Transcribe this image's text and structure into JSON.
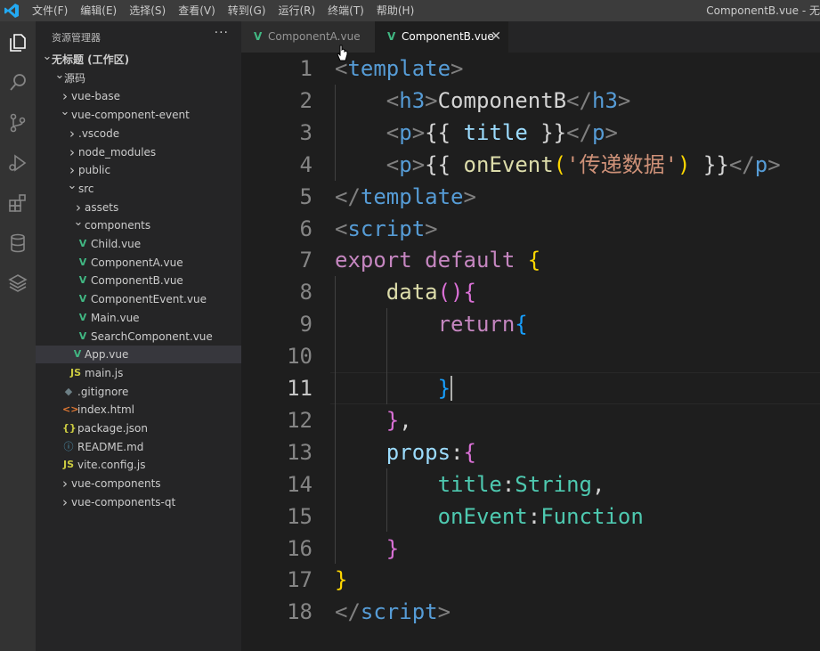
{
  "menu": [
    "文件(F)",
    "编辑(E)",
    "选择(S)",
    "查看(V)",
    "转到(G)",
    "运行(R)",
    "终端(T)",
    "帮助(H)"
  ],
  "window_title": "ComponentB.vue - 无",
  "activity_icons": [
    "explorer-icon",
    "search-icon",
    "source-control-icon",
    "run-debug-icon",
    "extensions-icon",
    "database-icon",
    "layers-icon"
  ],
  "sidebar": {
    "header": "资源管理器",
    "more": "···",
    "tree": [
      {
        "label": "无标题 (工作区)",
        "icon": "chevron-down",
        "bold": true
      },
      {
        "label": "源码",
        "icon": "chevron-down"
      },
      {
        "label": "vue-base",
        "icon": "chevron-right"
      },
      {
        "label": "vue-component-event",
        "icon": "chevron-down"
      },
      {
        "label": ".vscode",
        "icon": "chevron-right"
      },
      {
        "label": "node_modules",
        "icon": "chevron-right"
      },
      {
        "label": "public",
        "icon": "chevron-right"
      },
      {
        "label": "src",
        "icon": "chevron-down"
      },
      {
        "label": "assets",
        "icon": "chevron-right"
      },
      {
        "label": "components",
        "icon": "chevron-down"
      },
      {
        "label": "Child.vue",
        "icon": "vue"
      },
      {
        "label": "ComponentA.vue",
        "icon": "vue"
      },
      {
        "label": "ComponentB.vue",
        "icon": "vue"
      },
      {
        "label": "ComponentEvent.vue",
        "icon": "vue"
      },
      {
        "label": "Main.vue",
        "icon": "vue"
      },
      {
        "label": "SearchComponent.vue",
        "icon": "vue"
      },
      {
        "label": "App.vue",
        "icon": "vue",
        "selected": true
      },
      {
        "label": "main.js",
        "icon": "js"
      },
      {
        "label": ".gitignore",
        "icon": "git"
      },
      {
        "label": "index.html",
        "icon": "html"
      },
      {
        "label": "package.json",
        "icon": "json"
      },
      {
        "label": "README.md",
        "icon": "md"
      },
      {
        "label": "vite.config.js",
        "icon": "js"
      },
      {
        "label": "vue-components",
        "icon": "chevron-right"
      },
      {
        "label": "vue-components-qt",
        "icon": "chevron-right"
      }
    ]
  },
  "tabs": [
    {
      "label": "ComponentA.vue",
      "active": false
    },
    {
      "label": "ComponentB.vue",
      "active": true,
      "close": "✕"
    }
  ],
  "editor": {
    "current_line": 11,
    "lines": [
      {
        "n": "1",
        "tokens": [
          [
            "<",
            "pun"
          ],
          [
            "template",
            "tag"
          ],
          [
            ">",
            "pun"
          ]
        ]
      },
      {
        "n": "2",
        "tokens": [
          [
            "    ",
            "txt"
          ],
          [
            "<",
            "pun"
          ],
          [
            "h3",
            "tag"
          ],
          [
            ">",
            "pun"
          ],
          [
            "ComponentB",
            "txt"
          ],
          [
            "</",
            "pun"
          ],
          [
            "h3",
            "tag"
          ],
          [
            ">",
            "pun"
          ]
        ]
      },
      {
        "n": "3",
        "tokens": [
          [
            "    ",
            "txt"
          ],
          [
            "<",
            "pun"
          ],
          [
            "p",
            "tag"
          ],
          [
            ">",
            "pun"
          ],
          [
            "{{ ",
            "txt"
          ],
          [
            "title",
            "var"
          ],
          [
            " }}",
            "txt"
          ],
          [
            "</",
            "pun"
          ],
          [
            "p",
            "tag"
          ],
          [
            ">",
            "pun"
          ]
        ]
      },
      {
        "n": "4",
        "tokens": [
          [
            "    ",
            "txt"
          ],
          [
            "<",
            "pun"
          ],
          [
            "p",
            "tag"
          ],
          [
            ">",
            "pun"
          ],
          [
            "{{ ",
            "txt"
          ],
          [
            "onEvent",
            "fn"
          ],
          [
            "(",
            "br1"
          ],
          [
            "'传递数据'",
            "str"
          ],
          [
            ")",
            "br1"
          ],
          [
            " }}",
            "txt"
          ],
          [
            "</",
            "pun"
          ],
          [
            "p",
            "tag"
          ],
          [
            ">",
            "pun"
          ]
        ]
      },
      {
        "n": "5",
        "tokens": [
          [
            "</",
            "pun"
          ],
          [
            "template",
            "tag"
          ],
          [
            ">",
            "pun"
          ]
        ]
      },
      {
        "n": "6",
        "tokens": [
          [
            "<",
            "pun"
          ],
          [
            "script",
            "tag"
          ],
          [
            ">",
            "pun"
          ]
        ]
      },
      {
        "n": "7",
        "tokens": [
          [
            "export",
            "kw"
          ],
          [
            " ",
            "txt"
          ],
          [
            "default",
            "kw"
          ],
          [
            " ",
            "txt"
          ],
          [
            "{",
            "br1"
          ]
        ]
      },
      {
        "n": "8",
        "tokens": [
          [
            "    ",
            "txt"
          ],
          [
            "data",
            "fn"
          ],
          [
            "()",
            "br2"
          ],
          [
            "{",
            "br2"
          ]
        ]
      },
      {
        "n": "9",
        "tokens": [
          [
            "        ",
            "txt"
          ],
          [
            "return",
            "kw"
          ],
          [
            "{",
            "br3"
          ]
        ]
      },
      {
        "n": "10",
        "tokens": []
      },
      {
        "n": "11",
        "tokens": [
          [
            "        ",
            "txt"
          ],
          [
            "}",
            "br3"
          ]
        ]
      },
      {
        "n": "12",
        "tokens": [
          [
            "    ",
            "txt"
          ],
          [
            "}",
            "br2"
          ],
          [
            ",",
            "txt"
          ]
        ]
      },
      {
        "n": "13",
        "tokens": [
          [
            "    ",
            "txt"
          ],
          [
            "props",
            "var"
          ],
          [
            ":",
            "txt"
          ],
          [
            "{",
            "br2"
          ]
        ]
      },
      {
        "n": "14",
        "tokens": [
          [
            "        ",
            "txt"
          ],
          [
            "title",
            "prop"
          ],
          [
            ":",
            "txt"
          ],
          [
            "String",
            "prop"
          ],
          [
            ",",
            "txt"
          ]
        ]
      },
      {
        "n": "15",
        "tokens": [
          [
            "        ",
            "txt"
          ],
          [
            "onEvent",
            "prop"
          ],
          [
            ":",
            "txt"
          ],
          [
            "Function",
            "prop"
          ]
        ]
      },
      {
        "n": "16",
        "tokens": [
          [
            "    ",
            "txt"
          ],
          [
            "}",
            "br2"
          ]
        ]
      },
      {
        "n": "17",
        "tokens": [
          [
            "}",
            "br1"
          ]
        ]
      },
      {
        "n": "18",
        "tokens": [
          [
            "</",
            "pun"
          ],
          [
            "script",
            "tag"
          ],
          [
            ">",
            "pun"
          ]
        ]
      }
    ]
  }
}
